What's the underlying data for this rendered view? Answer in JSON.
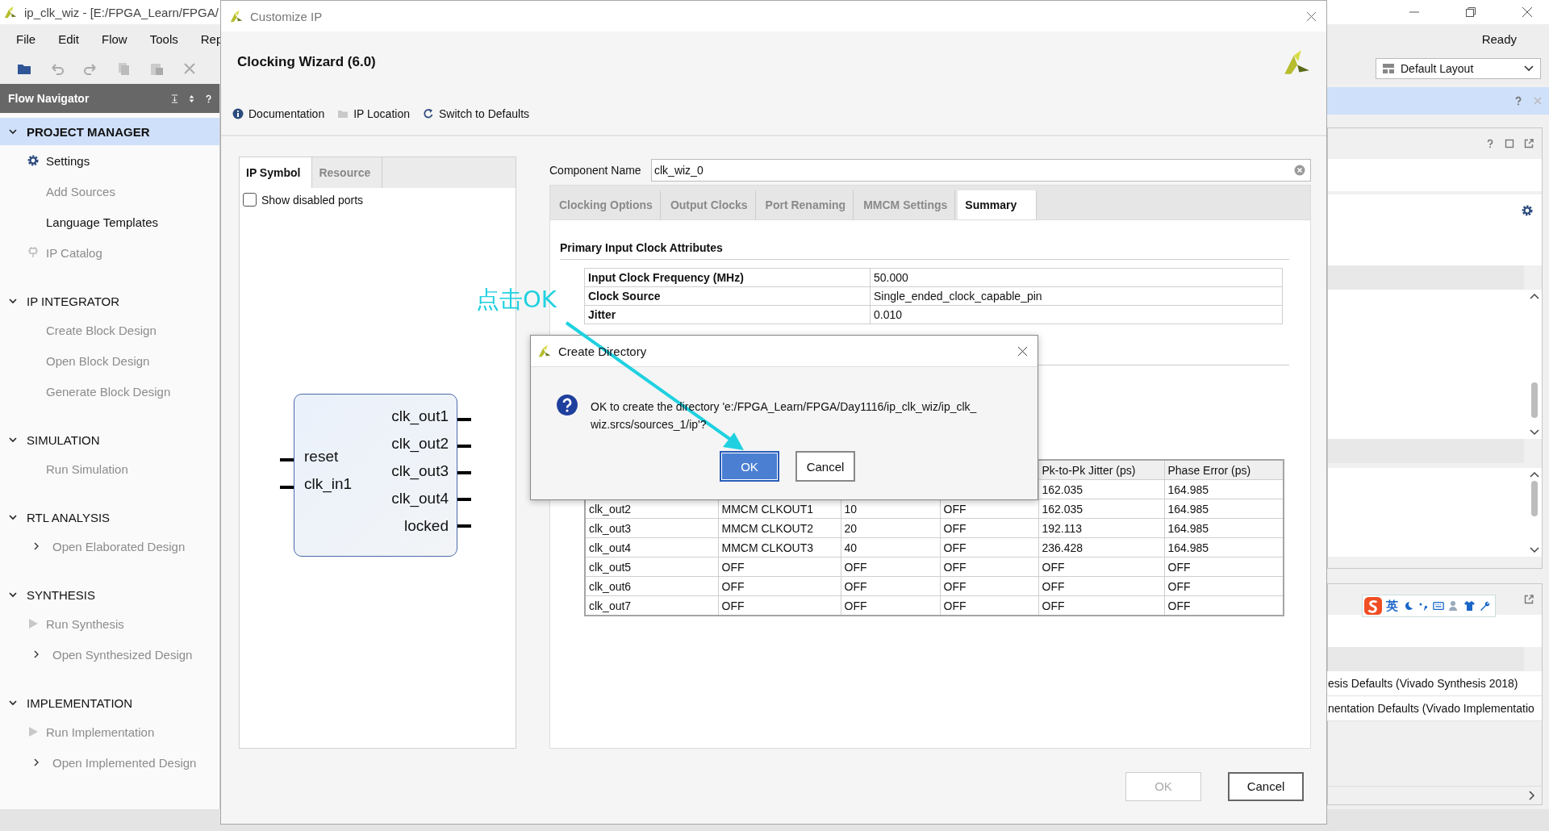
{
  "main_window": {
    "title": "ip_clk_wiz - [E:/FPGA_Learn/FPGA/",
    "menu": [
      "File",
      "Edit",
      "Flow",
      "Tools",
      "Rep"
    ],
    "status": "Ready",
    "layout_dropdown": "Default Layout",
    "flow_navigator": {
      "title": "Flow Navigator",
      "sections": [
        {
          "label": "PROJECT MANAGER",
          "expanded": true,
          "selected": true,
          "items": [
            {
              "label": "Settings",
              "kind": "settings",
              "disabled": false
            },
            {
              "label": "Add Sources",
              "kind": "plain",
              "disabled": true
            },
            {
              "label": "Language Templates",
              "kind": "plain",
              "disabled": false
            },
            {
              "label": "IP Catalog",
              "kind": "catalog",
              "disabled": true
            }
          ]
        },
        {
          "label": "IP INTEGRATOR",
          "expanded": true,
          "selected": false,
          "items": [
            {
              "label": "Create Block Design",
              "kind": "plain",
              "disabled": true
            },
            {
              "label": "Open Block Design",
              "kind": "plain",
              "disabled": true
            },
            {
              "label": "Generate Block Design",
              "kind": "plain",
              "disabled": true
            }
          ]
        },
        {
          "label": "SIMULATION",
          "expanded": true,
          "selected": false,
          "items": [
            {
              "label": "Run Simulation",
              "kind": "plain",
              "disabled": true
            }
          ]
        },
        {
          "label": "RTL ANALYSIS",
          "expanded": true,
          "selected": false,
          "items": [
            {
              "label": "Open Elaborated Design",
              "kind": "open",
              "disabled": true
            }
          ]
        },
        {
          "label": "SYNTHESIS",
          "expanded": true,
          "selected": false,
          "items": [
            {
              "label": "Run Synthesis",
              "kind": "run",
              "disabled": true
            },
            {
              "label": "Open Synthesized Design",
              "kind": "open",
              "disabled": true
            }
          ]
        },
        {
          "label": "IMPLEMENTATION",
          "expanded": true,
          "selected": false,
          "items": [
            {
              "label": "Run Implementation",
              "kind": "run",
              "disabled": true
            },
            {
              "label": "Open Implemented Design",
              "kind": "open",
              "disabled": true
            }
          ]
        }
      ]
    },
    "right_panel_rows": [
      "esis Defaults (Vivado Synthesis 2018)",
      "nentation Defaults (Vivado Implementatio"
    ],
    "ime_toolbar": {
      "language": "英"
    }
  },
  "customize_ip": {
    "title": "Customize IP",
    "heading": "Clocking Wizard (6.0)",
    "links": [
      {
        "label": "Documentation",
        "kind": "info"
      },
      {
        "label": "IP Location",
        "kind": "folder"
      },
      {
        "label": "Switch to Defaults",
        "kind": "refresh"
      }
    ],
    "left_tabs": [
      {
        "label": "IP Symbol",
        "selected": true
      },
      {
        "label": "Resource",
        "selected": false
      }
    ],
    "show_disabled_ports": {
      "label": "Show disabled ports",
      "checked": false
    },
    "symbol": {
      "inputs": [
        "reset",
        "clk_in1"
      ],
      "outputs": [
        "clk_out1",
        "clk_out2",
        "clk_out3",
        "clk_out4",
        "locked"
      ]
    },
    "component_name": {
      "label": "Component Name",
      "value": "clk_wiz_0"
    },
    "tabs": [
      {
        "label": "Clocking Options",
        "selected": false
      },
      {
        "label": "Output Clocks",
        "selected": false
      },
      {
        "label": "Port Renaming",
        "selected": false
      },
      {
        "label": "MMCM Settings",
        "selected": false
      },
      {
        "label": "Summary",
        "selected": true
      }
    ],
    "summary": {
      "section_title": "Primary Input Clock Attributes",
      "attributes": [
        {
          "name": "Input Clock Frequency (MHz)",
          "value": "50.000"
        },
        {
          "name": "Clock Source",
          "value": "Single_ended_clock_capable_pin"
        },
        {
          "name": "Jitter",
          "value": "0.010"
        }
      ],
      "output_table": {
        "columns": [
          "Pk-to-Pk Jitter (ps)",
          "Phase Error (ps)"
        ],
        "rows": [
          [
            "162.035",
            "164.985"
          ],
          [
            "clk_out2",
            "MMCM CLKOUT1",
            "10",
            "OFF",
            "162.035",
            "164.985"
          ],
          [
            "clk_out3",
            "MMCM CLKOUT2",
            "20",
            "OFF",
            "192.113",
            "164.985"
          ],
          [
            "clk_out4",
            "MMCM CLKOUT3",
            "40",
            "OFF",
            "236.428",
            "164.985"
          ],
          [
            "clk_out5",
            "OFF",
            "OFF",
            "OFF",
            "OFF",
            "OFF"
          ],
          [
            "clk_out6",
            "OFF",
            "OFF",
            "OFF",
            "OFF",
            "OFF"
          ],
          [
            "clk_out7",
            "OFF",
            "OFF",
            "OFF",
            "OFF",
            "OFF"
          ]
        ]
      }
    },
    "buttons": [
      {
        "label": "OK",
        "disabled": true
      },
      {
        "label": "Cancel",
        "disabled": false
      }
    ]
  },
  "create_directory_dialog": {
    "title": "Create Directory",
    "message_lines": [
      "OK to create the directory 'e:/FPGA_Learn/FPGA/Day1116/ip_clk_wiz/ip_clk_",
      "wiz.srcs/sources_1/ip'?"
    ],
    "buttons": [
      {
        "label": "OK",
        "selected": true
      },
      {
        "label": "Cancel",
        "selected": false
      }
    ]
  },
  "annotation": {
    "text": "点击OK"
  }
}
